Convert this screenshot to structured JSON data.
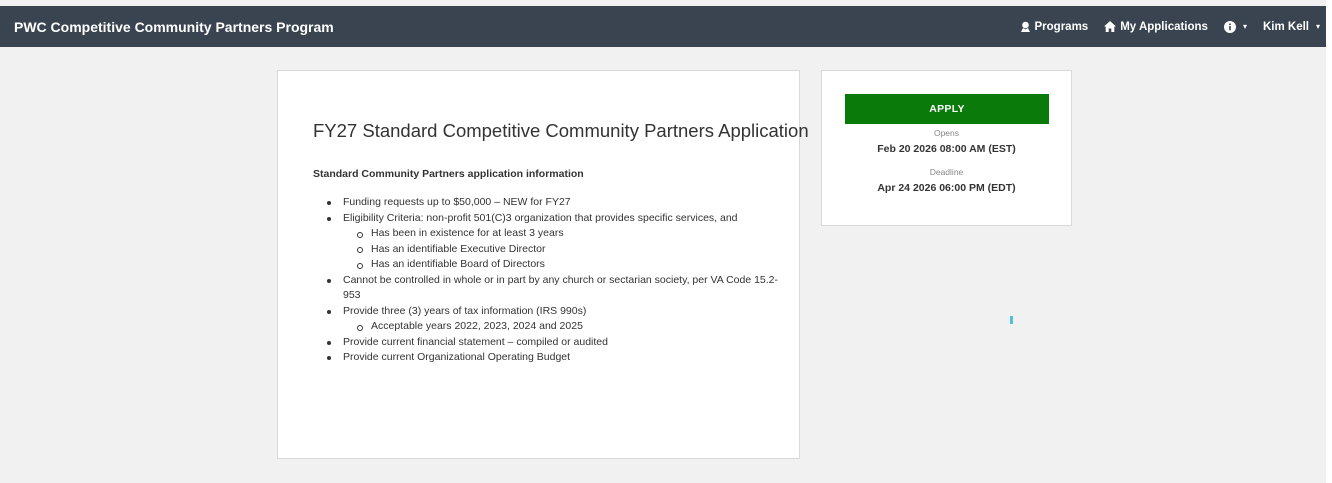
{
  "header": {
    "brand": "PWC Competitive Community Partners Program",
    "nav": {
      "programs": "Programs",
      "my_applications": "My Applications",
      "user": "Kim Kell"
    }
  },
  "application": {
    "title": "FY27 Standard Competitive Community Partners Application",
    "section_heading": "Standard Community Partners application information",
    "items": [
      "Funding requests up to $50,000 – NEW for FY27",
      "Eligibility Criteria: non-profit 501(C)3 organization that provides specific services, and",
      "Cannot be controlled in whole or in part by any church or sectarian society, per VA Code 15.2-953",
      "Provide three (3) years of tax information (IRS 990s)",
      "Provide current financial statement – compiled or audited",
      "Provide current Organizational Operating Budget"
    ],
    "eligibility_sub": [
      "Has been in existence for at least 3 years",
      "Has an identifiable Executive Director",
      "Has an identifiable Board of Directors"
    ],
    "tax_sub": [
      "Acceptable years 2022, 2023, 2024 and 2025"
    ]
  },
  "sidebar": {
    "apply_label": "APPLY",
    "opens_label": "Opens",
    "opens_value": "Feb 20 2026 08:00 AM (EST)",
    "deadline_label": "Deadline",
    "deadline_value": "Apr 24 2026 06:00 PM (EDT)"
  },
  "colors": {
    "topbar": "#3a4450",
    "apply_button": "#0a7a0a",
    "loader": "#4ec3e0"
  },
  "icons": {
    "programs": "award-icon",
    "my_applications": "home-icon",
    "help": "info-circle-icon"
  }
}
